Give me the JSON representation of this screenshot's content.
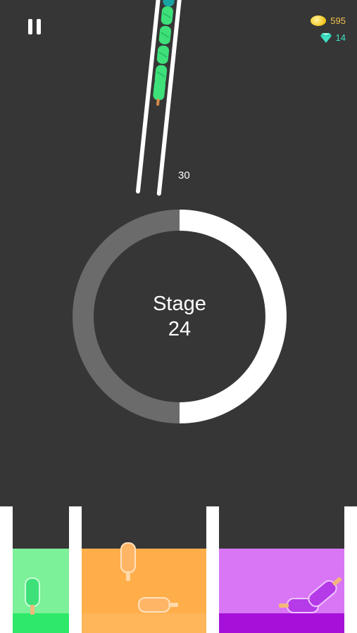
{
  "hud": {
    "pause_icon": "pause-icon",
    "coins": "595",
    "gems": "14",
    "coin_icon": "coin-icon",
    "gem_icon": "diamond-icon"
  },
  "tube": {
    "count": "30",
    "popsicle_color": "#3ee07a"
  },
  "stage": {
    "label": "Stage",
    "number": "24",
    "progress": 0.5,
    "ring_filled_color": "#ffffff",
    "ring_empty_color": "#6b6b6b"
  },
  "bins": [
    {
      "color": "green",
      "fill": "#7df09a",
      "base": "#2ee86a"
    },
    {
      "color": "orange",
      "fill": "#ffae4a",
      "base": "#ffb559"
    },
    {
      "color": "purple",
      "fill": "#d876f5",
      "base": "#a511d8"
    }
  ],
  "colors": {
    "background": "#363636",
    "coin_text": "#f2c14e",
    "gem_text": "#3ee0c4"
  }
}
